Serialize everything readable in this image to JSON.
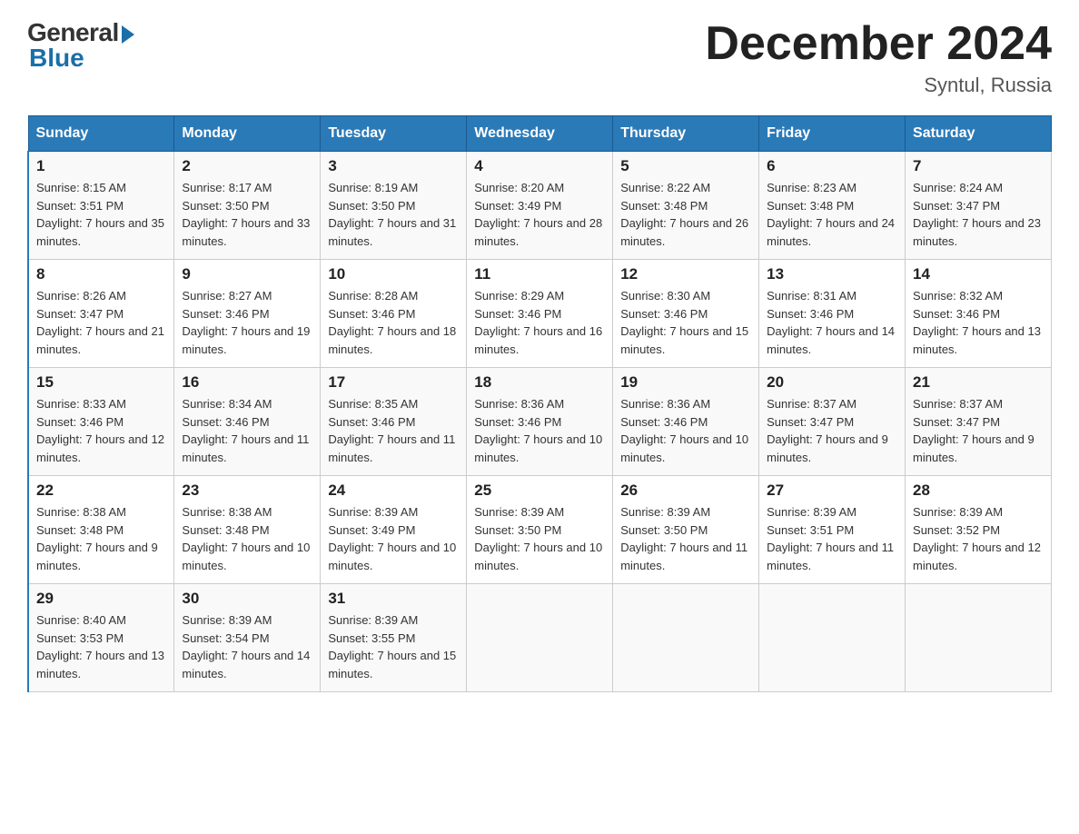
{
  "logo": {
    "general": "General",
    "blue": "Blue"
  },
  "title": "December 2024",
  "subtitle": "Syntul, Russia",
  "headers": [
    "Sunday",
    "Monday",
    "Tuesday",
    "Wednesday",
    "Thursday",
    "Friday",
    "Saturday"
  ],
  "weeks": [
    [
      {
        "day": "1",
        "sunrise": "8:15 AM",
        "sunset": "3:51 PM",
        "daylight": "7 hours and 35 minutes."
      },
      {
        "day": "2",
        "sunrise": "8:17 AM",
        "sunset": "3:50 PM",
        "daylight": "7 hours and 33 minutes."
      },
      {
        "day": "3",
        "sunrise": "8:19 AM",
        "sunset": "3:50 PM",
        "daylight": "7 hours and 31 minutes."
      },
      {
        "day": "4",
        "sunrise": "8:20 AM",
        "sunset": "3:49 PM",
        "daylight": "7 hours and 28 minutes."
      },
      {
        "day": "5",
        "sunrise": "8:22 AM",
        "sunset": "3:48 PM",
        "daylight": "7 hours and 26 minutes."
      },
      {
        "day": "6",
        "sunrise": "8:23 AM",
        "sunset": "3:48 PM",
        "daylight": "7 hours and 24 minutes."
      },
      {
        "day": "7",
        "sunrise": "8:24 AM",
        "sunset": "3:47 PM",
        "daylight": "7 hours and 23 minutes."
      }
    ],
    [
      {
        "day": "8",
        "sunrise": "8:26 AM",
        "sunset": "3:47 PM",
        "daylight": "7 hours and 21 minutes."
      },
      {
        "day": "9",
        "sunrise": "8:27 AM",
        "sunset": "3:46 PM",
        "daylight": "7 hours and 19 minutes."
      },
      {
        "day": "10",
        "sunrise": "8:28 AM",
        "sunset": "3:46 PM",
        "daylight": "7 hours and 18 minutes."
      },
      {
        "day": "11",
        "sunrise": "8:29 AM",
        "sunset": "3:46 PM",
        "daylight": "7 hours and 16 minutes."
      },
      {
        "day": "12",
        "sunrise": "8:30 AM",
        "sunset": "3:46 PM",
        "daylight": "7 hours and 15 minutes."
      },
      {
        "day": "13",
        "sunrise": "8:31 AM",
        "sunset": "3:46 PM",
        "daylight": "7 hours and 14 minutes."
      },
      {
        "day": "14",
        "sunrise": "8:32 AM",
        "sunset": "3:46 PM",
        "daylight": "7 hours and 13 minutes."
      }
    ],
    [
      {
        "day": "15",
        "sunrise": "8:33 AM",
        "sunset": "3:46 PM",
        "daylight": "7 hours and 12 minutes."
      },
      {
        "day": "16",
        "sunrise": "8:34 AM",
        "sunset": "3:46 PM",
        "daylight": "7 hours and 11 minutes."
      },
      {
        "day": "17",
        "sunrise": "8:35 AM",
        "sunset": "3:46 PM",
        "daylight": "7 hours and 11 minutes."
      },
      {
        "day": "18",
        "sunrise": "8:36 AM",
        "sunset": "3:46 PM",
        "daylight": "7 hours and 10 minutes."
      },
      {
        "day": "19",
        "sunrise": "8:36 AM",
        "sunset": "3:46 PM",
        "daylight": "7 hours and 10 minutes."
      },
      {
        "day": "20",
        "sunrise": "8:37 AM",
        "sunset": "3:47 PM",
        "daylight": "7 hours and 9 minutes."
      },
      {
        "day": "21",
        "sunrise": "8:37 AM",
        "sunset": "3:47 PM",
        "daylight": "7 hours and 9 minutes."
      }
    ],
    [
      {
        "day": "22",
        "sunrise": "8:38 AM",
        "sunset": "3:48 PM",
        "daylight": "7 hours and 9 minutes."
      },
      {
        "day": "23",
        "sunrise": "8:38 AM",
        "sunset": "3:48 PM",
        "daylight": "7 hours and 10 minutes."
      },
      {
        "day": "24",
        "sunrise": "8:39 AM",
        "sunset": "3:49 PM",
        "daylight": "7 hours and 10 minutes."
      },
      {
        "day": "25",
        "sunrise": "8:39 AM",
        "sunset": "3:50 PM",
        "daylight": "7 hours and 10 minutes."
      },
      {
        "day": "26",
        "sunrise": "8:39 AM",
        "sunset": "3:50 PM",
        "daylight": "7 hours and 11 minutes."
      },
      {
        "day": "27",
        "sunrise": "8:39 AM",
        "sunset": "3:51 PM",
        "daylight": "7 hours and 11 minutes."
      },
      {
        "day": "28",
        "sunrise": "8:39 AM",
        "sunset": "3:52 PM",
        "daylight": "7 hours and 12 minutes."
      }
    ],
    [
      {
        "day": "29",
        "sunrise": "8:40 AM",
        "sunset": "3:53 PM",
        "daylight": "7 hours and 13 minutes."
      },
      {
        "day": "30",
        "sunrise": "8:39 AM",
        "sunset": "3:54 PM",
        "daylight": "7 hours and 14 minutes."
      },
      {
        "day": "31",
        "sunrise": "8:39 AM",
        "sunset": "3:55 PM",
        "daylight": "7 hours and 15 minutes."
      },
      null,
      null,
      null,
      null
    ]
  ]
}
